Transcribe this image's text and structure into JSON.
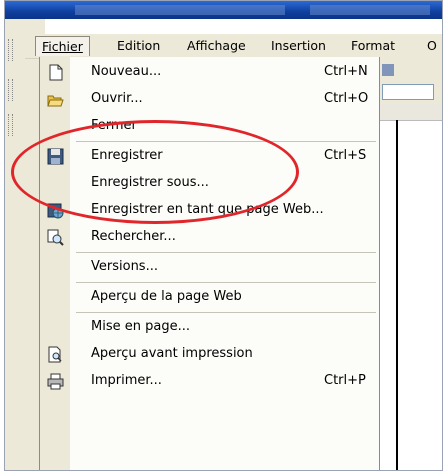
{
  "menubar": {
    "items": [
      {
        "label": "Fichier",
        "active": true
      },
      {
        "label": "Edition"
      },
      {
        "label": "Affichage"
      },
      {
        "label": "Insertion"
      },
      {
        "label": "Format"
      },
      {
        "label": "O"
      }
    ]
  },
  "file_menu": {
    "nouveau": {
      "label": "Nouveau...",
      "shortcut": "Ctrl+N",
      "icon": "new-document-icon"
    },
    "ouvrir": {
      "label": "Ouvrir...",
      "shortcut": "Ctrl+O",
      "icon": "open-folder-icon"
    },
    "fermer": {
      "label": "Fermer"
    },
    "enregistrer": {
      "label": "Enregistrer",
      "shortcut": "Ctrl+S",
      "icon": "floppy-disk-icon"
    },
    "enregistrer_sous": {
      "label": "Enregistrer sous..."
    },
    "enregistrer_web": {
      "label": "Enregistrer en tant que page Web...",
      "icon": "save-web-page-icon"
    },
    "rechercher": {
      "label": "Rechercher...",
      "icon": "search-files-icon"
    },
    "versions": {
      "label": "Versions..."
    },
    "apercu_web": {
      "label": "Aperçu de la page Web"
    },
    "mise_en_page": {
      "label": "Mise en page..."
    },
    "apercu_impression": {
      "label": "Aperçu avant impression",
      "icon": "print-preview-icon"
    },
    "imprimer": {
      "label": "Imprimer...",
      "shortcut": "Ctrl+P",
      "icon": "printer-icon"
    }
  },
  "annotation": {
    "color": "#e0262a"
  }
}
